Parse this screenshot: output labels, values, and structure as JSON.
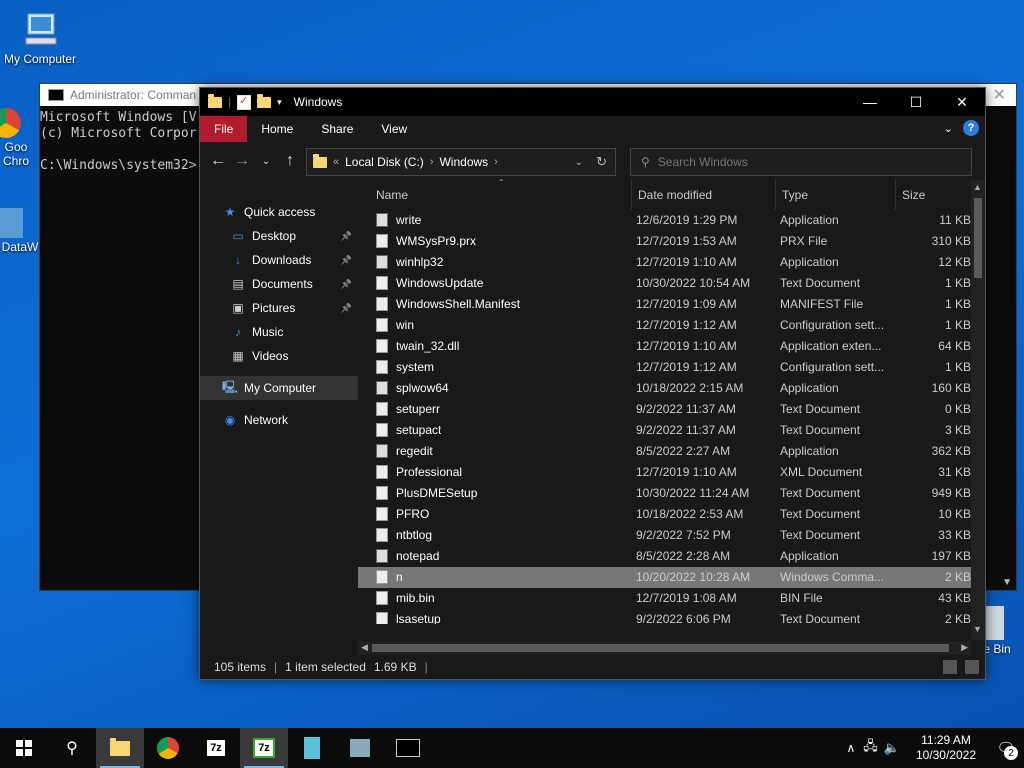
{
  "desktop": {
    "icons": [
      {
        "label": "My Computer"
      },
      {
        "label": "Goo"
      },
      {
        "label": "Chro"
      },
      {
        "label": "DataW"
      },
      {
        "label": "e Bin"
      }
    ]
  },
  "cmd": {
    "title": "Administrator: Comman",
    "lines": [
      "Microsoft Windows [V",
      "(c) Microsoft Corpor",
      "",
      "C:\\Windows\\system32>"
    ]
  },
  "explorer": {
    "title": "Windows",
    "ribbon": {
      "file": "File",
      "home": "Home",
      "share": "Share",
      "view": "View",
      "help": "?"
    },
    "address": {
      "prefix": "«",
      "crumbs": [
        "Local Disk (C:)",
        "Windows"
      ]
    },
    "search_placeholder": "Search Windows",
    "nav": [
      {
        "label": "Quick access",
        "icon": "star-icon",
        "pin": false
      },
      {
        "label": "Desktop",
        "icon": "desktop-icon",
        "pin": true
      },
      {
        "label": "Downloads",
        "icon": "download-icon",
        "pin": true
      },
      {
        "label": "Documents",
        "icon": "documents-icon",
        "pin": true
      },
      {
        "label": "Pictures",
        "icon": "pictures-icon",
        "pin": true
      },
      {
        "label": "Music",
        "icon": "music-icon",
        "pin": false
      },
      {
        "label": "Videos",
        "icon": "videos-icon",
        "pin": false
      },
      {
        "label": "My Computer",
        "icon": "computer-icon",
        "pin": false
      },
      {
        "label": "Network",
        "icon": "network-icon",
        "pin": false
      }
    ],
    "columns": {
      "name": "Name",
      "date": "Date modified",
      "type": "Type",
      "size": "Size"
    },
    "files": [
      {
        "name": "write",
        "date": "12/6/2019 1:29 PM",
        "type": "Application",
        "size": "11 KB"
      },
      {
        "name": "WMSysPr9.prx",
        "date": "12/7/2019 1:53 AM",
        "type": "PRX File",
        "size": "310 KB"
      },
      {
        "name": "winhlp32",
        "date": "12/7/2019 1:10 AM",
        "type": "Application",
        "size": "12 KB"
      },
      {
        "name": "WindowsUpdate",
        "date": "10/30/2022 10:54 AM",
        "type": "Text Document",
        "size": "1 KB"
      },
      {
        "name": "WindowsShell.Manifest",
        "date": "12/7/2019 1:09 AM",
        "type": "MANIFEST File",
        "size": "1 KB"
      },
      {
        "name": "win",
        "date": "12/7/2019 1:12 AM",
        "type": "Configuration sett...",
        "size": "1 KB"
      },
      {
        "name": "twain_32.dll",
        "date": "12/7/2019 1:10 AM",
        "type": "Application exten...",
        "size": "64 KB"
      },
      {
        "name": "system",
        "date": "12/7/2019 1:12 AM",
        "type": "Configuration sett...",
        "size": "1 KB"
      },
      {
        "name": "splwow64",
        "date": "10/18/2022 2:15 AM",
        "type": "Application",
        "size": "160 KB"
      },
      {
        "name": "setuperr",
        "date": "9/2/2022 11:37 AM",
        "type": "Text Document",
        "size": "0 KB"
      },
      {
        "name": "setupact",
        "date": "9/2/2022 11:37 AM",
        "type": "Text Document",
        "size": "3 KB"
      },
      {
        "name": "regedit",
        "date": "8/5/2022 2:27 AM",
        "type": "Application",
        "size": "362 KB"
      },
      {
        "name": "Professional",
        "date": "12/7/2019 1:10 AM",
        "type": "XML Document",
        "size": "31 KB"
      },
      {
        "name": "PlusDMESetup",
        "date": "10/30/2022 11:24 AM",
        "type": "Text Document",
        "size": "949 KB"
      },
      {
        "name": "PFRO",
        "date": "10/18/2022 2:53 AM",
        "type": "Text Document",
        "size": "10 KB"
      },
      {
        "name": "ntbtlog",
        "date": "9/2/2022 7:52 PM",
        "type": "Text Document",
        "size": "33 KB"
      },
      {
        "name": "notepad",
        "date": "8/5/2022 2:28 AM",
        "type": "Application",
        "size": "197 KB"
      },
      {
        "name": "n",
        "date": "10/20/2022 10:28 AM",
        "type": "Windows Comma...",
        "size": "2 KB",
        "selected": true
      },
      {
        "name": "mib.bin",
        "date": "12/7/2019 1:08 AM",
        "type": "BIN File",
        "size": "43 KB"
      },
      {
        "name": "lsasetup",
        "date": "9/2/2022 6:06 PM",
        "type": "Text Document",
        "size": "2 KB"
      }
    ],
    "status": {
      "count": "105 items",
      "selection": "1 item selected",
      "size": "1.69 KB"
    }
  },
  "taskbar": {
    "time": "11:29 AM",
    "date": "10/30/2022",
    "notifications": "2",
    "apps": [
      "start-icon",
      "search-icon",
      "file-explorer-icon",
      "chrome-icon",
      "7zip-icon",
      "7zip-fm-icon",
      "datawarehouse-icon",
      "network-setup-icon",
      "cmd-icon"
    ]
  },
  "colors": {
    "accent": "#b01c2e",
    "desktop": "#0c6fd8",
    "selection": "#777777"
  }
}
